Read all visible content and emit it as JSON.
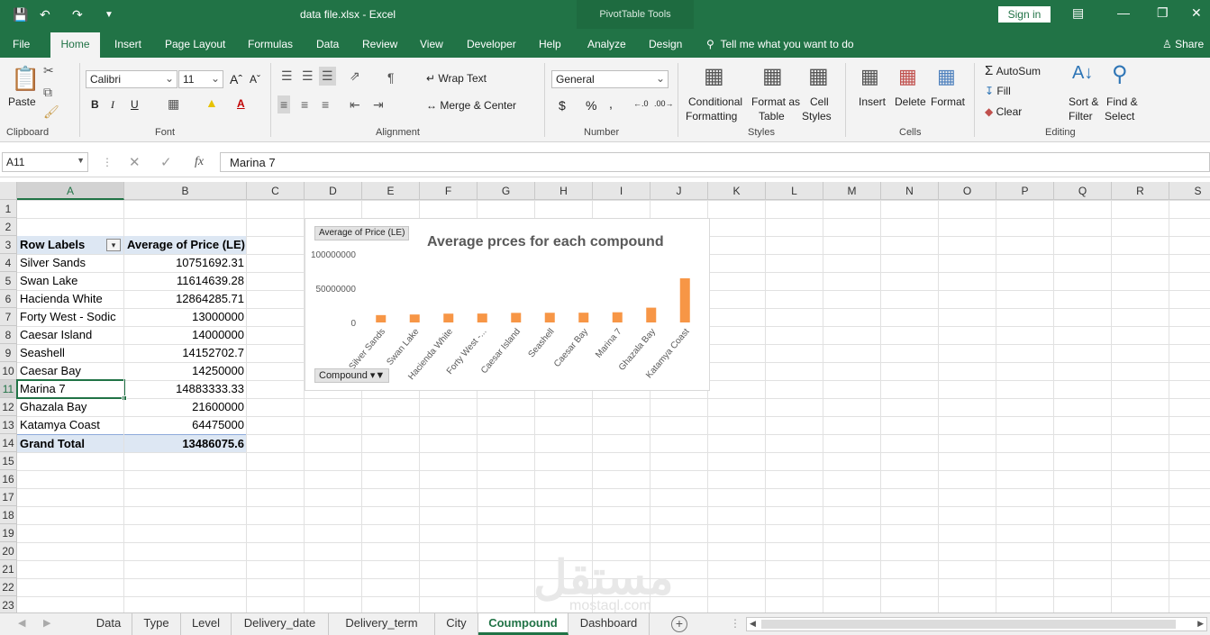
{
  "window": {
    "title": "data file.xlsx  -  Excel",
    "contextual_tab_group": "PivotTable Tools",
    "sign_in": "Sign in"
  },
  "ribbon_tabs": [
    "File",
    "Home",
    "Insert",
    "Page Layout",
    "Formulas",
    "Data",
    "Review",
    "View",
    "Developer",
    "Help",
    "Analyze",
    "Design"
  ],
  "active_tab": "Home",
  "tell_me": "Tell me what you want to do",
  "share": "Share",
  "ribbon": {
    "clipboard": {
      "label": "Clipboard",
      "paste": "Paste"
    },
    "font": {
      "label": "Font",
      "family": "Calibri",
      "size": "11",
      "bold": "B",
      "italic": "I",
      "underline": "U"
    },
    "alignment": {
      "label": "Alignment",
      "wrap_text": "Wrap Text",
      "merge_center": "Merge & Center"
    },
    "number": {
      "label": "Number",
      "format": "General",
      "currency": "$",
      "percent": "%",
      "comma": ","
    },
    "styles": {
      "label": "Styles",
      "conditional_1": "Conditional",
      "conditional_2": "Formatting",
      "format_table_1": "Format as",
      "format_table_2": "Table",
      "cell_styles_1": "Cell",
      "cell_styles_2": "Styles"
    },
    "cells": {
      "label": "Cells",
      "insert": "Insert",
      "delete": "Delete",
      "format": "Format"
    },
    "editing": {
      "label": "Editing",
      "autosum": "AutoSum",
      "fill": "Fill",
      "clear": "Clear",
      "sort_1": "Sort &",
      "sort_2": "Filter",
      "find_1": "Find &",
      "find_2": "Select"
    }
  },
  "formula_bar": {
    "name_box": "A11",
    "fx": "fx",
    "value": "Marina 7"
  },
  "columns": [
    "A",
    "B",
    "C",
    "D",
    "E",
    "F",
    "G",
    "H",
    "I",
    "J",
    "K",
    "L",
    "M",
    "N",
    "O",
    "P",
    "Q",
    "R",
    "S"
  ],
  "rows": [
    "1",
    "2",
    "3",
    "4",
    "5",
    "6",
    "7",
    "8",
    "9",
    "10",
    "11",
    "12",
    "13",
    "14",
    "15",
    "16",
    "17",
    "18",
    "19",
    "20",
    "21",
    "22",
    "23"
  ],
  "pivot": {
    "header_label": "Row Labels",
    "header_value": "Average of Price (LE)",
    "rows": [
      {
        "label": "Silver Sands",
        "value": "10751692.31"
      },
      {
        "label": "Swan Lake",
        "value": "11614639.28"
      },
      {
        "label": "Hacienda White",
        "value": "12864285.71"
      },
      {
        "label": "Forty West - Sodic",
        "value": "13000000"
      },
      {
        "label": "Caesar Island",
        "value": "14000000"
      },
      {
        "label": "Seashell",
        "value": "14152702.7"
      },
      {
        "label": "Caesar Bay",
        "value": "14250000"
      },
      {
        "label": "Marina 7",
        "value": "14883333.33"
      },
      {
        "label": "Ghazala Bay",
        "value": "21600000"
      },
      {
        "label": "Katamya Coast",
        "value": "64475000"
      }
    ],
    "total_label": "Grand Total",
    "total_value": "13486075.6"
  },
  "chart_data": {
    "type": "bar",
    "title": "Average prces for each compound",
    "field_button": "Average of Price (LE)",
    "axis_button": "Compound",
    "categories": [
      "Silver Sands",
      "Swan Lake",
      "Hacienda White",
      "Forty West -...",
      "Caesar Island",
      "Seashell",
      "Caesar Bay",
      "Marina 7",
      "Ghazala Bay",
      "Katamya Coast"
    ],
    "values": [
      10751692.31,
      11614639.28,
      12864285.71,
      13000000,
      14000000,
      14152702.7,
      14250000,
      14883333.33,
      21600000,
      64475000
    ],
    "ylim": [
      0,
      100000000
    ],
    "yticks": [
      "0",
      "50000000",
      "100000000"
    ],
    "bar_color": "#f79646",
    "legend": "none",
    "grid": false
  },
  "sheet_tabs": [
    "Data",
    "Type",
    "Level",
    "Delivery_date",
    "Delivery_term",
    "City",
    "Coumpound",
    "Dashboard"
  ],
  "active_sheet": "Coumpound",
  "watermark": {
    "main": "مستقل",
    "sub": "mostaql.com"
  },
  "colors": {
    "excel_green": "#217346",
    "pivot_header": "#dde7f3"
  }
}
